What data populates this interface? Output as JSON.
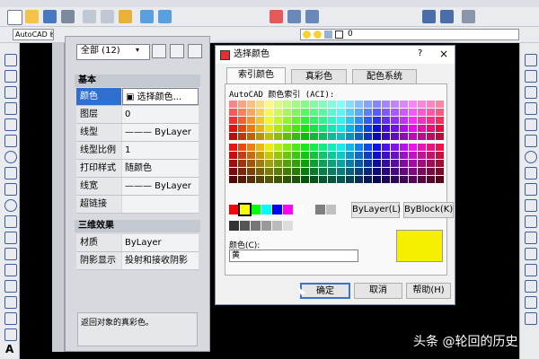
{
  "properties": {
    "filter_select": "全部 (12)",
    "group_basic": "基本",
    "basic_rows": [
      {
        "key": "颜色",
        "value": "▣ 选择颜色..."
      },
      {
        "key": "图层",
        "value": "0"
      },
      {
        "key": "线型",
        "value": "——— ByLayer"
      },
      {
        "key": "线型比例",
        "value": "1"
      },
      {
        "key": "打印样式",
        "value": "随颜色"
      },
      {
        "key": "线宽",
        "value": "——— ByLayer"
      },
      {
        "key": "超链接",
        "value": ""
      }
    ],
    "group_3d": "三维效果",
    "rows_3d": [
      {
        "key": "材质",
        "value": "ByLayer"
      },
      {
        "key": "阴影显示",
        "value": "投射和接收阴影"
      }
    ],
    "description": "返回对象的真彩色。"
  },
  "dialog": {
    "title": "选择颜色",
    "help_glyph": "?",
    "close_glyph": "×",
    "tabs": [
      "索引颜色",
      "真彩色",
      "配色系统"
    ],
    "aci_label": "AutoCAD 颜色索引 (ACI):",
    "bylayer_button": "ByLayer(L)",
    "byblock_button": "ByBlock(K)",
    "color_label": "颜色(C):",
    "color_value": "黄",
    "ok_button": "确定",
    "cancel_button": "取消",
    "help_button": "帮助(H)",
    "preview_color": "#f4f000"
  },
  "toolbar": {
    "drawing_name_tab": "AutoCAD 经典",
    "layer_value": "0"
  },
  "watermark": "头条 @轮回的历史"
}
